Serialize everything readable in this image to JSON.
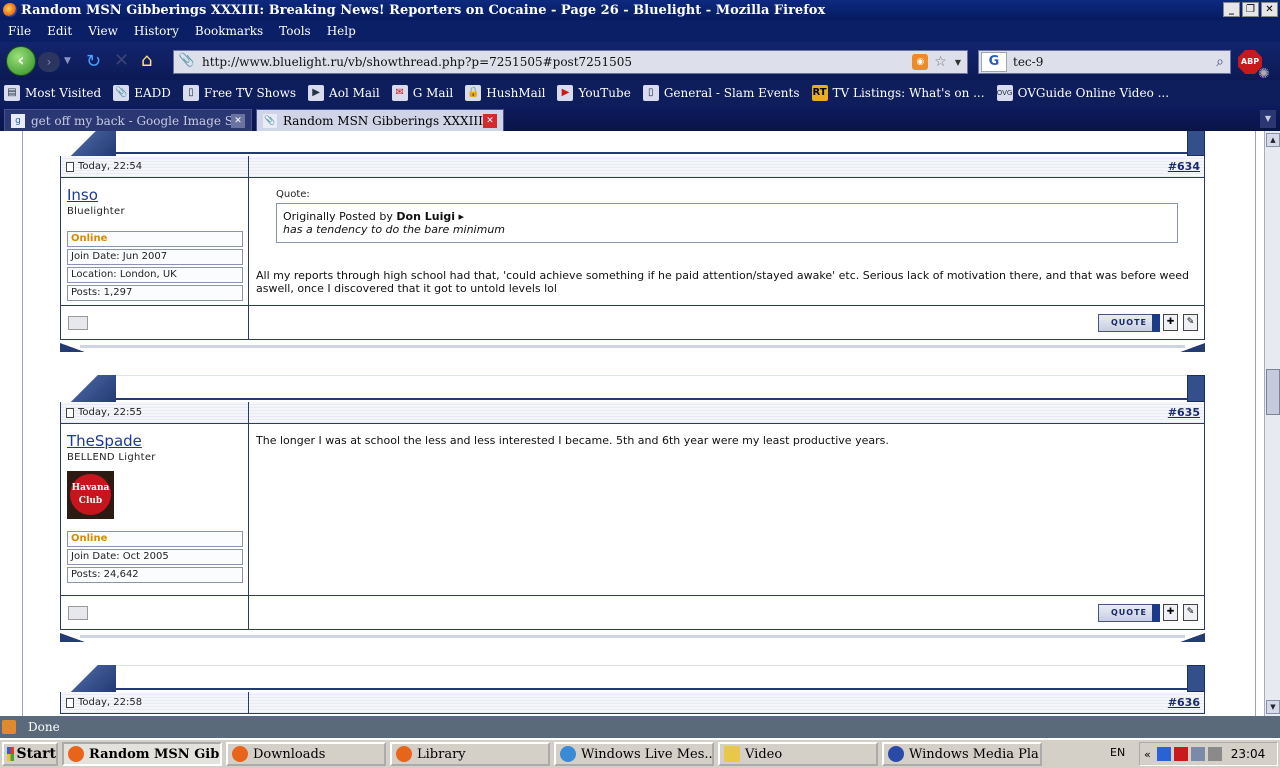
{
  "window": {
    "title": "Random MSN Gibberings XXXIII: Breaking News! Reporters on Cocaine - Page 26 - Bluelight - Mozilla Firefox"
  },
  "menu": [
    "File",
    "Edit",
    "View",
    "History",
    "Bookmarks",
    "Tools",
    "Help"
  ],
  "nav": {
    "url": "http://www.bluelight.ru/vb/showthread.php?p=7251505#post7251505",
    "search_query": "tec-9",
    "search_engine_letter": "G",
    "abp_label": "ABP"
  },
  "bookmarks": [
    {
      "label": "Most Visited",
      "icon": "most-visited-icon"
    },
    {
      "label": "EADD",
      "icon": "paperclip-icon"
    },
    {
      "label": "Free TV Shows",
      "icon": "page-icon"
    },
    {
      "label": "Aol Mail",
      "icon": "aol-icon"
    },
    {
      "label": "G Mail",
      "icon": "gmail-icon"
    },
    {
      "label": "HushMail",
      "icon": "hushmail-icon"
    },
    {
      "label": "YouTube",
      "icon": "youtube-icon"
    },
    {
      "label": "General - Slam Events",
      "icon": "page-icon"
    },
    {
      "label": "TV Listings: What's on ...",
      "icon": "rt-icon"
    },
    {
      "label": "OVGuide Online Video ...",
      "icon": "ovg-icon"
    }
  ],
  "tabs": [
    {
      "label": "get off my back - Google Image Se...",
      "active": false
    },
    {
      "label": "Random MSN Gibberings XXXIII:...",
      "active": true
    }
  ],
  "posts": [
    {
      "date": "Today, 22:54",
      "number": "#634",
      "username": "Inso",
      "usertitle": "Bluelighter",
      "status": "Online",
      "info": [
        "Join Date: Jun 2007",
        "Location: London, UK",
        "Posts: 1,297"
      ],
      "quote": {
        "label": "Quote:",
        "prefix": "Originally Posted by",
        "author": "Don Luigi",
        "text": "has a tendency to do the bare minimum"
      },
      "text": "All my reports through high school had that, 'could achieve something if he paid attention/stayed awake' etc. Serious lack of motivation there, and that was before weed aswell, once I discovered that it got to untold levels lol",
      "quote_button": "QUOTE"
    },
    {
      "date": "Today, 22:55",
      "number": "#635",
      "username": "TheSpade",
      "usertitle": "BELLEND Lighter",
      "avatar": {
        "line1": "Havana",
        "line2": "Club"
      },
      "status": "Online",
      "info": [
        "Join Date: Oct 2005",
        "Posts: 24,642"
      ],
      "text": "The longer I was at school the less and less interested I became. 5th and 6th year were my least productive years.",
      "quote_button": "QUOTE"
    },
    {
      "date": "Today, 22:58",
      "number": "#636"
    }
  ],
  "statusbar": {
    "text": "Done"
  },
  "taskbar": {
    "start": "Start",
    "tasks": [
      {
        "label": "Random MSN Gib...",
        "active": true,
        "color": "#e8641a"
      },
      {
        "label": "Downloads",
        "active": false,
        "color": "#e8641a"
      },
      {
        "label": "Library",
        "active": false,
        "color": "#e8641a"
      },
      {
        "label": "Windows Live Mes...",
        "active": false,
        "color": "#3a8ad6"
      },
      {
        "label": "Video",
        "active": false,
        "color": "#e8c84a"
      },
      {
        "label": "Windows Media Pla...",
        "active": false,
        "color": "#2a4aa8"
      }
    ],
    "lang": "EN",
    "clock": "23:04"
  }
}
